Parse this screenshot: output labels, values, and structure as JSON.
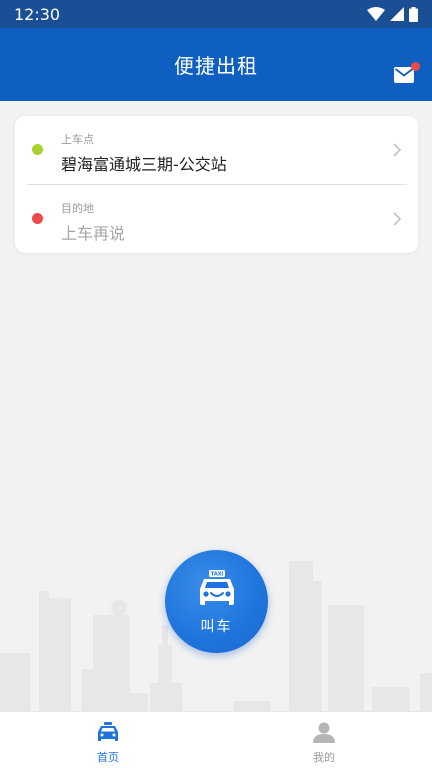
{
  "status_bar": {
    "time": "12:30",
    "icons": [
      "wifi-icon",
      "signal-icon",
      "battery-icon"
    ]
  },
  "header": {
    "title": "便捷出租",
    "mail_icon": "mail-icon",
    "has_unread": true
  },
  "trip": {
    "pickup": {
      "label": "上车点",
      "value": "碧海富通城三期-公交站"
    },
    "destination": {
      "label": "目的地",
      "placeholder": "上车再说"
    }
  },
  "call_button": {
    "label": "叫车",
    "icon": "taxi-icon"
  },
  "tabs": [
    {
      "label": "首页",
      "icon": "taxi-tab-icon",
      "active": true
    },
    {
      "label": "我的",
      "icon": "person-icon",
      "active": false
    }
  ],
  "colors": {
    "primary": "#0e5fbf",
    "status_bar": "#1a4f96",
    "pickup_dot": "#a8d22a",
    "destination_dot": "#ef4b4b",
    "background": "#f2f2f2"
  }
}
